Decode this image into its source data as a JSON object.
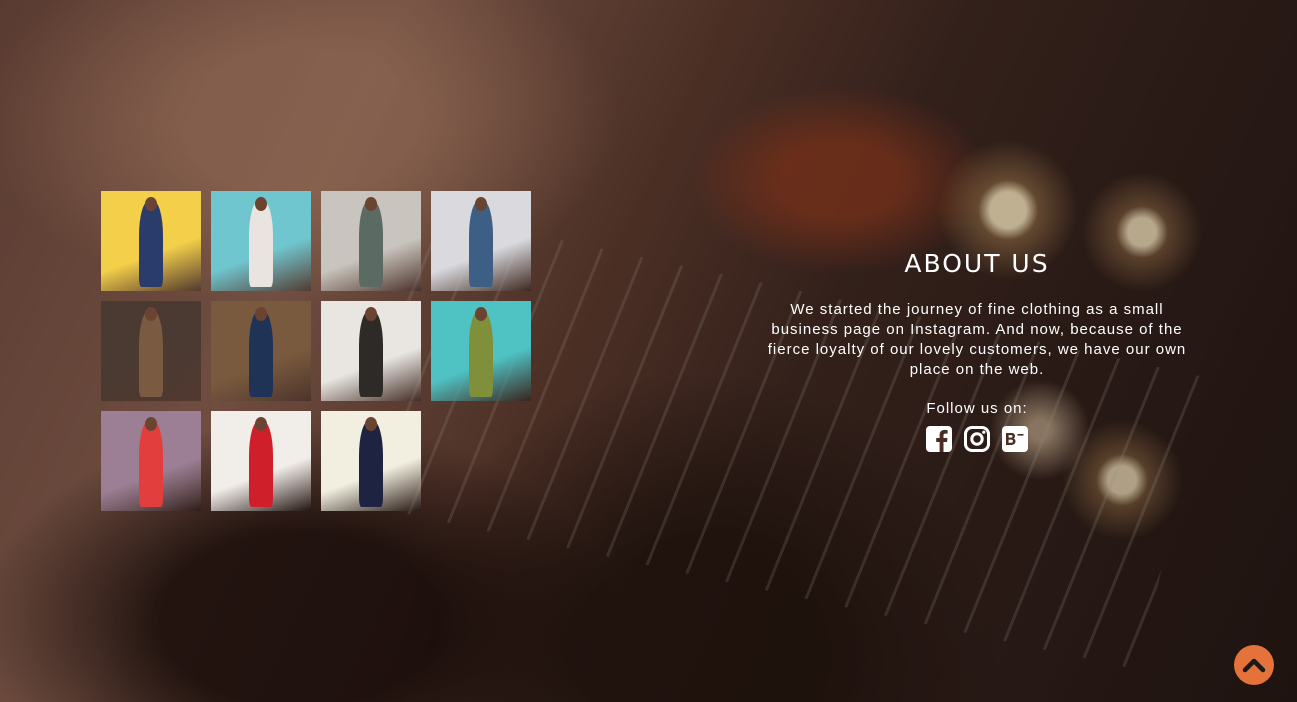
{
  "about": {
    "title": "ABOUT US",
    "description": "We started the journey of fine clothing as a small business page on Instagram. And now, because of the fierce loyalty of our lovely customers, we have our own place on the web.",
    "follow_label": "Follow us on:"
  },
  "socials": [
    {
      "name": "facebook-icon"
    },
    {
      "name": "instagram-icon"
    },
    {
      "name": "behance-icon"
    }
  ],
  "gallery": [
    {
      "bg": "#f3cf4a",
      "outfit": "#2a3c6b"
    },
    {
      "bg": "#6fc6cf",
      "outfit": "#e9e4df"
    },
    {
      "bg": "#c9c4bd",
      "outfit": "#5b6a63"
    },
    {
      "bg": "#d9d9de",
      "outfit": "#3d5f86"
    },
    {
      "bg": "#4b3a32",
      "outfit": "#7b5a42"
    },
    {
      "bg": "#7a5a3e",
      "outfit": "#1f3357"
    },
    {
      "bg": "#e9e6e2",
      "outfit": "#2e2a27"
    },
    {
      "bg": "#4fc2c4",
      "outfit": "#7f8f3a"
    },
    {
      "bg": "#9c7f95",
      "outfit": "#e23e3e"
    },
    {
      "bg": "#f1ede9",
      "outfit": "#cf1f2a"
    },
    {
      "bg": "#f2efe0",
      "outfit": "#1d2340"
    }
  ],
  "colors": {
    "accent": "#e4723a"
  },
  "scroll_top": {
    "icon": "chevron-up-icon"
  }
}
